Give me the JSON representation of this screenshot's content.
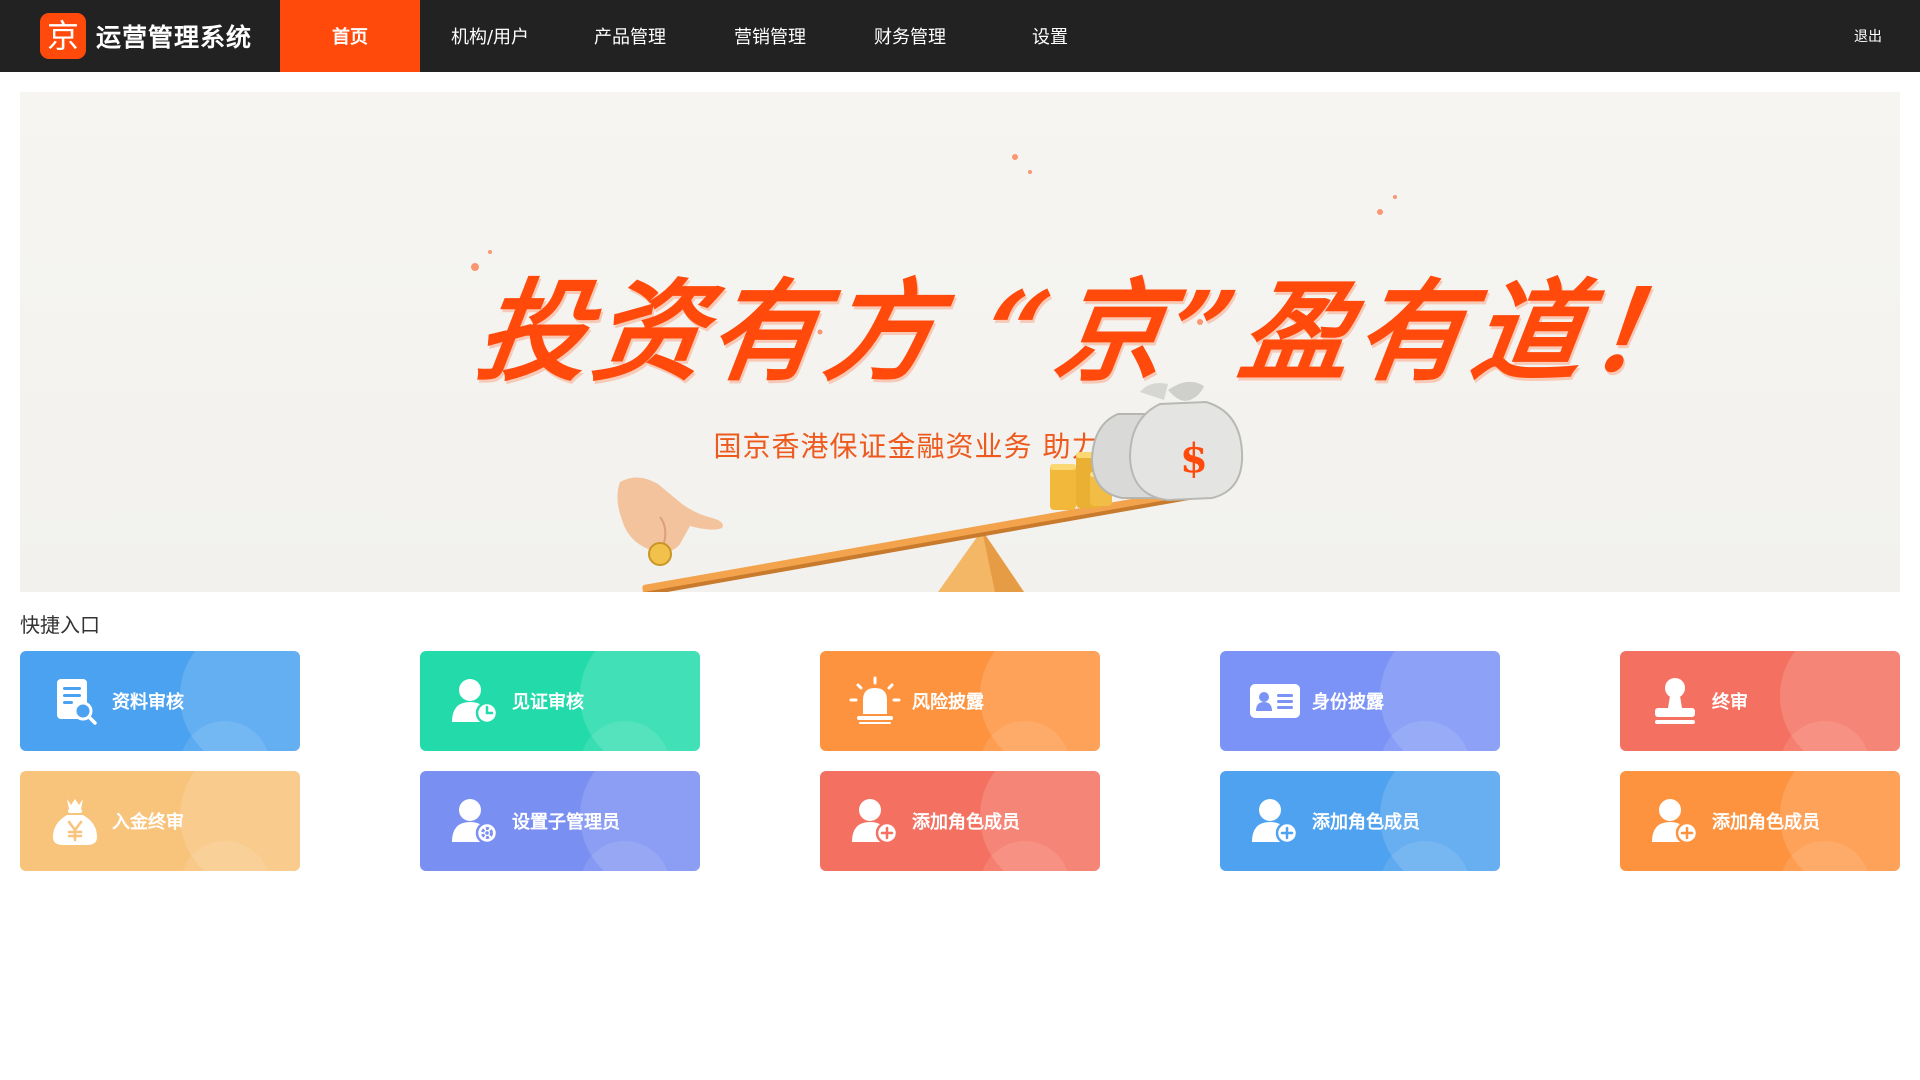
{
  "app": {
    "logo_char": "京",
    "title": "运营管理系统"
  },
  "nav": {
    "items": [
      {
        "label": "首页",
        "active": true
      },
      {
        "label": "机构/用户",
        "active": false
      },
      {
        "label": "产品管理",
        "active": false
      },
      {
        "label": "营销管理",
        "active": false
      },
      {
        "label": "财务管理",
        "active": false
      },
      {
        "label": "设置",
        "active": false
      }
    ],
    "logout_label": "退出"
  },
  "banner": {
    "slogan": "投资有方 “京”盈有道！",
    "subtitle": "国京香港保证金融资业务 助力您的投资",
    "illustration": "seesaw-coins-money-bags",
    "bag_symbol": "$"
  },
  "quick_entry": {
    "title": "快捷入口",
    "cards": [
      {
        "label": "资料审核",
        "icon": "document-search-icon",
        "color": "#4ba2f0"
      },
      {
        "label": "见证审核",
        "icon": "user-clock-icon",
        "color": "#23dbaa"
      },
      {
        "label": "风险披露",
        "icon": "alarm-light-icon",
        "color": "#fe933f"
      },
      {
        "label": "身份披露",
        "icon": "id-card-icon",
        "color": "#7b93f6"
      },
      {
        "label": "终审",
        "icon": "stamp-icon",
        "color": "#f47161"
      },
      {
        "label": "入金终审",
        "icon": "money-bag-icon",
        "color": "#f8c37b"
      },
      {
        "label": "设置子管理员",
        "icon": "user-gear-icon",
        "color": "#7a8ff2"
      },
      {
        "label": "添加角色成员",
        "icon": "user-add-icon",
        "color": "#f47161"
      },
      {
        "label": "添加角色成员",
        "icon": "user-add-icon",
        "color": "#4ea2ef"
      },
      {
        "label": "添加角色成员",
        "icon": "user-add-icon",
        "color": "#fe933f"
      }
    ]
  },
  "colors": {
    "topbar": "#222222",
    "accent": "#ff4a0c"
  }
}
